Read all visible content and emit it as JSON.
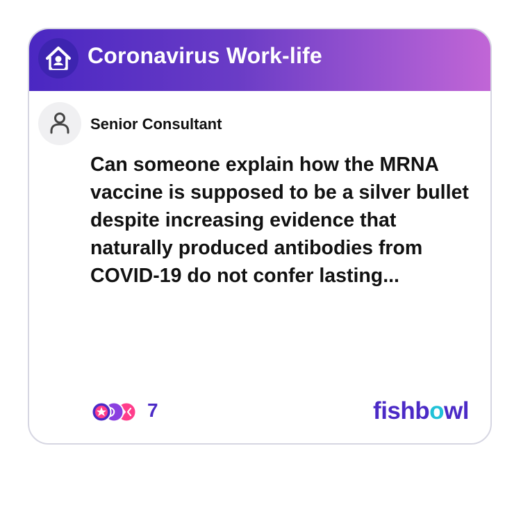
{
  "bowl": {
    "title": "Coronavirus Work-life",
    "icon": "house-person-icon"
  },
  "post": {
    "author_title": "Senior Consultant",
    "avatar_icon": "person-outline-icon",
    "text": "Can someone explain how the MRNA vaccine is supposed to be a silver bullet despite increasing evidence that naturally produced antibodies from COVID-19 do not confer lasting..."
  },
  "reactions": {
    "count": "7",
    "icon": "reaction-faces-icon"
  },
  "brand": {
    "part1": "fishb",
    "part2": "o",
    "part3": "wl"
  },
  "colors": {
    "header_gradient_start": "#4a27c2",
    "header_gradient_end": "#c266d6",
    "brand_purple": "#4b2ac6",
    "brand_teal": "#21c2d8",
    "card_border": "#d6d6e2"
  }
}
